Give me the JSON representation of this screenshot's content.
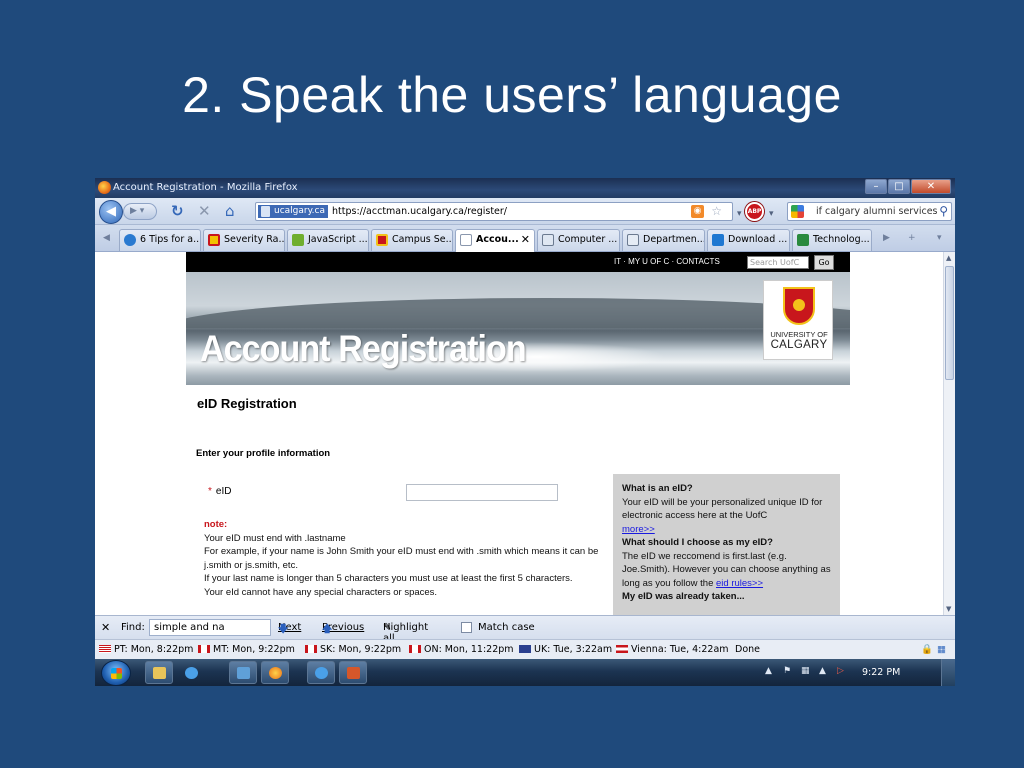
{
  "slide": {
    "title": "2. Speak the users’ language"
  },
  "browser": {
    "window_title": "Account Registration - Mozilla Firefox",
    "site_identity": "ucalgary.ca",
    "url": "https://acctman.ucalgary.ca/register/",
    "search_text": "if calgary alumni services",
    "tabs": [
      {
        "label": "6 Tips for a...",
        "icon": "tips-icon"
      },
      {
        "label": "Severity Ra...",
        "icon": "severity-icon"
      },
      {
        "label": "JavaScript ...",
        "icon": "javascript-icon"
      },
      {
        "label": "Campus Se...",
        "icon": "campus-icon"
      },
      {
        "label": "Accou...",
        "icon": "page-icon",
        "active": true
      },
      {
        "label": "Computer ...",
        "icon": "computer-icon"
      },
      {
        "label": "Departmen...",
        "icon": "department-icon"
      },
      {
        "label": "Download ...",
        "icon": "download-icon"
      },
      {
        "label": "Technolog...",
        "icon": "technology-icon"
      }
    ]
  },
  "page": {
    "top_links": "IT · MY U OF C · CONTACTS",
    "search_placeholder": "Search UofC",
    "go_label": "Go",
    "banner_title": "Account Registration",
    "logo_line1": "UNIVERSITY OF",
    "logo_line2": "CALGARY",
    "section_title": "eID Registration",
    "profile_heading": "Enter your profile information",
    "eid_label": "eID",
    "note_label": "note:",
    "note_lines": [
      "Your eID must end with .lastname",
      "For example, if your name is John Smith your eID must end with .smith which means it can be j.smith or js.smith, etc.",
      "If your last name is longer than 5 characters you must use at least the first 5 characters.",
      "Your eId cannot have any special characters or spaces."
    ],
    "sidebox": {
      "q1": "What is an eID?",
      "a1": "Your eID will be your personalized unique ID for electronic access here at the UofC",
      "more_link": "more>>",
      "q2": "What should I choose as my eID?",
      "a2": "The eID we reccomend is first.last (e.g. Joe.Smith). However you can choose anything as long as you follow the",
      "rules_link": "eid rules>>",
      "q3": "My eID was already taken..."
    }
  },
  "findbar": {
    "label": "Find:",
    "value": "simple and na",
    "next": "Next",
    "previous": "Previous",
    "highlight": "Highlight all",
    "match_case": "Match case"
  },
  "statusbar": {
    "zones": [
      {
        "text": "PT: Mon, 8:22pm",
        "flag": "us"
      },
      {
        "text": "MT: Mon, 9:22pm",
        "flag": "ca"
      },
      {
        "text": "SK: Mon, 9:22pm",
        "flag": "ca"
      },
      {
        "text": "ON: Mon, 11:22pm",
        "flag": "ca"
      },
      {
        "text": "UK: Tue, 3:22am",
        "flag": "uk"
      },
      {
        "text": "Vienna: Tue, 4:22am",
        "flag": "at"
      }
    ],
    "status": "Done"
  },
  "taskbar": {
    "clock": "9:22 PM"
  },
  "colors": {
    "slide_bg": "#1f4a7c",
    "accent_red": "#c8161c",
    "link_blue": "#1a1ae0"
  }
}
